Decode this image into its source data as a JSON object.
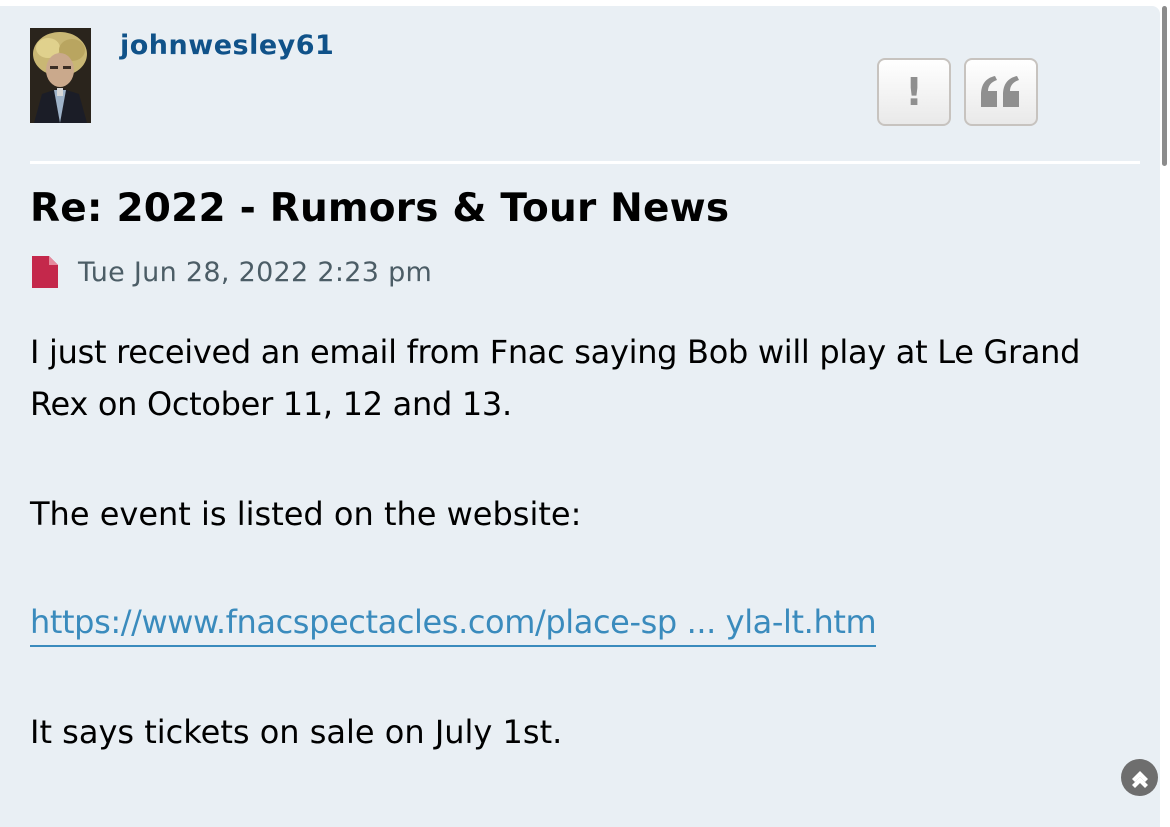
{
  "post": {
    "author": "johnwesley61",
    "title": "Re: 2022 - Rumors & Tour News",
    "date": "Tue Jun 28, 2022 2:23 pm",
    "paragraphs": [
      "I just received an email from Fnac saying Bob will play at Le Grand Rex on October 11, 12 and 13.",
      "The event is listed on the website:",
      "It says tickets on sale on July 1st."
    ],
    "link_text": "https://www.fnacspectacles.com/place-sp ... yla-lt.htm"
  },
  "buttons": {
    "report_glyph": "!",
    "report_icon": "exclamation-icon",
    "quote_icon": "quote-icon",
    "back_to_top_icon": "chevron-up-icon"
  },
  "colors": {
    "background": "#e9eff4",
    "username": "#105289",
    "link": "#3a8bbd",
    "meta_text": "#4c5d66",
    "file_icon": "#c4284b"
  }
}
